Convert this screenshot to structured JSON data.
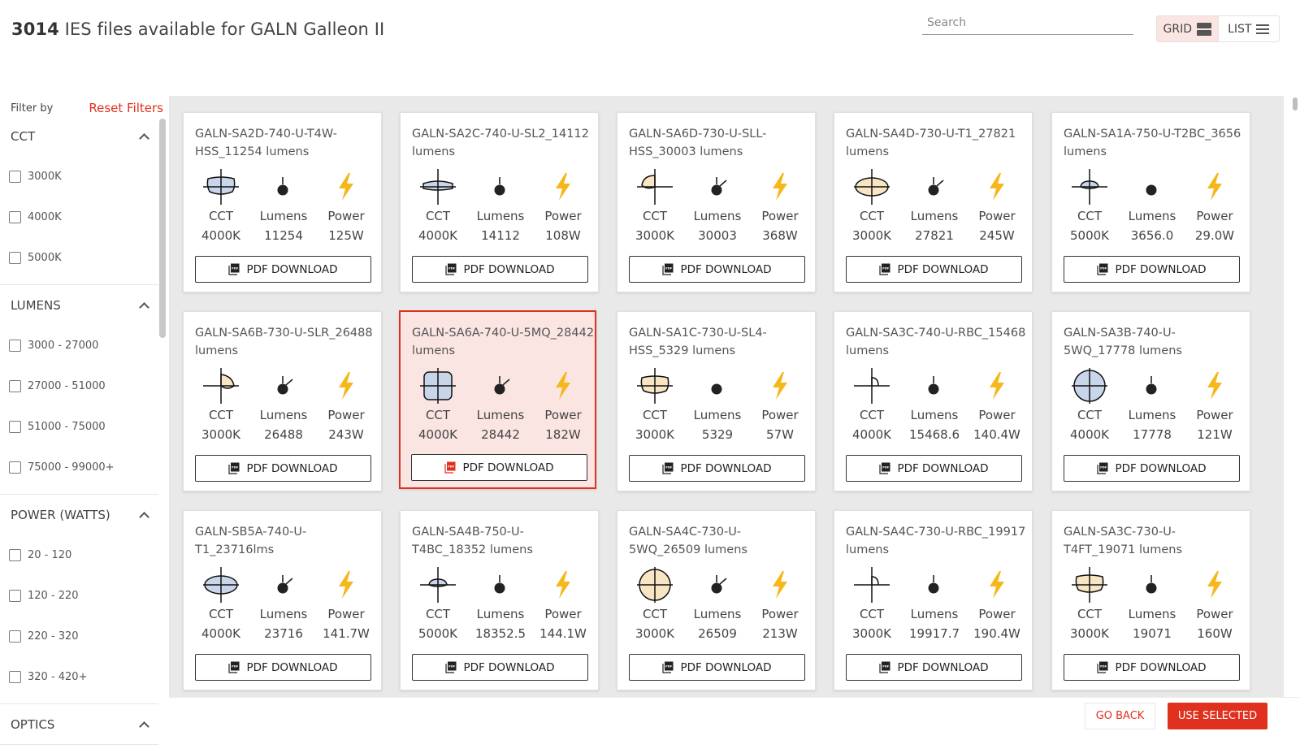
{
  "header": {
    "count": "3014",
    "title_rest": "IES files available for GALN Galleon II",
    "search_placeholder": "Search",
    "view_grid": "GRID",
    "view_list": "LIST"
  },
  "sidebar": {
    "filter_by": "Filter by",
    "reset": "Reset Filters",
    "sections": [
      {
        "title": "CCT",
        "options": [
          "3000K",
          "4000K",
          "5000K"
        ]
      },
      {
        "title": "LUMENS",
        "options": [
          "3000 - 27000",
          "27000 - 51000",
          "51000 - 75000",
          "75000 - 99000+"
        ]
      },
      {
        "title": "POWER (WATTS)",
        "options": [
          "20 - 120",
          "120 - 220",
          "220 - 320",
          "320 - 420+"
        ]
      },
      {
        "title": "OPTICS",
        "options": []
      }
    ]
  },
  "labels": {
    "cct": "CCT",
    "lumens": "Lumens",
    "power": "Power",
    "pdf": "PDF DOWNLOAD"
  },
  "colors": {
    "accent": "#e0301e",
    "power_bolt": "#f5b71a",
    "selected_bg": "#fbe5e3",
    "cool_fill": "#c9d6ea",
    "warm_fill": "#f7e5c4"
  },
  "cards": [
    {
      "title": "GALN-SA2D-740-U-T4W-HSS_11254 lumens",
      "cct": "4000K",
      "lumens": "11254",
      "power": "125W",
      "icon": "distribution-wide",
      "dot": "lumens-dot"
    },
    {
      "title": "GALN-SA2C-740-U-SL2_14112 lumens",
      "cct": "4000K",
      "lumens": "14112",
      "power": "108W",
      "icon": "distribution-flat",
      "dot": "lumens-dot"
    },
    {
      "title": "GALN-SA6D-730-U-SLL-HSS_30003 lumens",
      "cct": "3000K",
      "lumens": "30003",
      "power": "368W",
      "icon": "distribution-corner",
      "dot": "lumens-dot-tilt"
    },
    {
      "title": "GALN-SA4D-730-U-T1_27821 lumens",
      "cct": "3000K",
      "lumens": "27821",
      "power": "245W",
      "icon": "distribution-oval",
      "dot": "lumens-dot-tilt"
    },
    {
      "title": "GALN-SA1A-750-U-T2BC_3656 lumens",
      "cct": "5000K",
      "lumens": "3656.0",
      "power": "29.0W",
      "icon": "distribution-small",
      "dot": "lumens-dot-plain"
    },
    {
      "title": "GALN-SA6B-730-U-SLR_26488 lumens",
      "cct": "3000K",
      "lumens": "26488",
      "power": "243W",
      "icon": "distribution-corner-right",
      "dot": "lumens-dot-tilt"
    },
    {
      "title": "GALN-SA6A-740-U-5MQ_28442 lumens",
      "cct": "4000K",
      "lumens": "28442",
      "power": "182W",
      "icon": "distribution-square",
      "dot": "lumens-dot-tilt",
      "selected": true
    },
    {
      "title": "GALN-SA1C-730-U-SL4-HSS_5329 lumens",
      "cct": "3000K",
      "lumens": "5329",
      "power": "57W",
      "icon": "distribution-wide",
      "dot": "lumens-dot-plain"
    },
    {
      "title": "GALN-SA3C-740-U-RBC_15468 lumens",
      "cct": "4000K",
      "lumens": "15468.6",
      "power": "140.4W",
      "icon": "distribution-arc",
      "dot": "lumens-dot"
    },
    {
      "title": "GALN-SA3B-740-U-5WQ_17778 lumens",
      "cct": "4000K",
      "lumens": "17778",
      "power": "121W",
      "icon": "distribution-round",
      "dot": "lumens-dot"
    },
    {
      "title": "GALN-SB5A-740-U-T1_23716lms",
      "cct": "4000K",
      "lumens": "23716",
      "power": "141.7W",
      "icon": "distribution-oval",
      "dot": "lumens-dot-tilt"
    },
    {
      "title": "GALN-SA4B-750-U-T4BC_18352 lumens",
      "cct": "5000K",
      "lumens": "18352.5",
      "power": "144.1W",
      "icon": "distribution-small",
      "dot": "lumens-dot"
    },
    {
      "title": "GALN-SA4C-730-U-5WQ_26509 lumens",
      "cct": "3000K",
      "lumens": "26509",
      "power": "213W",
      "icon": "distribution-round",
      "dot": "lumens-dot-tilt"
    },
    {
      "title": "GALN-SA4C-730-U-RBC_19917 lumens",
      "cct": "3000K",
      "lumens": "19917.7",
      "power": "190.4W",
      "icon": "distribution-arc",
      "dot": "lumens-dot"
    },
    {
      "title": "GALN-SA3C-730-U-T4FT_19071 lumens",
      "cct": "3000K",
      "lumens": "19071",
      "power": "160W",
      "icon": "distribution-wide",
      "dot": "lumens-dot"
    }
  ],
  "footer": {
    "go_back": "GO BACK",
    "use_selected": "USE SELECTED"
  }
}
